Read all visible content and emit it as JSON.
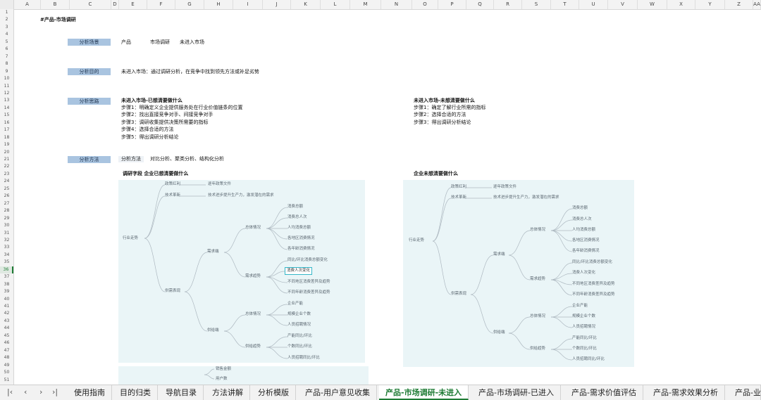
{
  "columns": [
    "A",
    "B",
    "C",
    "D",
    "E",
    "F",
    "G",
    "H",
    "I",
    "J",
    "K",
    "L",
    "M",
    "N",
    "O",
    "P",
    "Q",
    "R",
    "S",
    "T",
    "U",
    "V",
    "W",
    "X",
    "Y",
    "Z",
    "AA"
  ],
  "rows": [
    "1",
    "2",
    "3",
    "4",
    "5",
    "6",
    "7",
    "8",
    "9",
    "10",
    "11",
    "12",
    "13",
    "14",
    "15",
    "16",
    "17",
    "18",
    "19",
    "20",
    "21",
    "22",
    "23",
    "24",
    "25",
    "26",
    "27",
    "28",
    "29",
    "30",
    "31",
    "32",
    "33",
    "34",
    "35",
    "36",
    "37",
    "38",
    "39",
    "40",
    "41",
    "42",
    "43",
    "44",
    "45",
    "46",
    "47",
    "48",
    "49",
    "50",
    "51"
  ],
  "selected_row": "36",
  "sheet": {
    "title": "#产品-市场调研",
    "scene_label": "分析场景",
    "scene_values": [
      "产品",
      "市场调研",
      "未进入市场"
    ],
    "goal_label": "分析目的",
    "goal_text": "未进入市场：通过调研分析，在竞争中找到领先方法或补足劣势",
    "thinking_label": "分析思路",
    "left_heading": "未进入市场-已想清要做什么",
    "left_steps": [
      "步骤1：明确定义企业提供服务处在行业价值链条的位置",
      "步骤2：找出直接竞争对手、间接竞争对手",
      "步骤3：调研收集提供决策所需要的指标",
      "步骤4：选择合适的方法",
      "步骤5：得出调研分析结论"
    ],
    "right_heading": "未进入市场-未想清要做什么",
    "right_steps": [
      "步骤1：确定了解行业所需的指标",
      "步骤2：选择合适的方法",
      "步骤3：得出调研分析结论"
    ],
    "method_label": "分析方法",
    "method_cell_label": "分析方法",
    "method_text": "对比分析、聚类分析、结构化分析",
    "stage_heading": "调研字段 企业已想清要做什么",
    "stage_heading_right": "企业未想清要做什么"
  },
  "mindmap": {
    "root": "行业走势",
    "policy": "政策红利",
    "policy_leaf": "逐年政策文件",
    "tech": "技术革新",
    "tech_leaf": "技术进步提升生产力，激发潜在的需求",
    "supply_demand": "供需表现",
    "demand": "需求端",
    "overall": "总体情况",
    "overall_items": [
      "消费总额",
      "消费总人次",
      "人均消费总额",
      "各地区消费情况",
      "各年龄消费情况"
    ],
    "trend": "需求趋势",
    "trend_items": [
      "同比/环比消费总额变化",
      "消费人次变化",
      "不同地区消费差异及趋势",
      "不同年龄消费差异及趋势"
    ],
    "supply": "供给端",
    "supply_overall": "总体情况",
    "supply_overall_items": [
      "企业产能",
      "规模企业个数",
      "人员招聘情况"
    ],
    "supply_trend": "供给趋势",
    "supply_trend_items": [
      "产能同比/环比",
      "个数同比/环比",
      "人员招聘同比/环比"
    ]
  },
  "bottom_panel": [
    "销售金额",
    "用户数"
  ],
  "tabs": [
    "使用指南",
    "目的归类",
    "导航目录",
    "方法讲解",
    "分析模版",
    "产品-用户意见收集",
    "产品-市场调研-未进入",
    "产品-市场调研-已进入",
    "产品-需求价值评估",
    "产品-需求效果分析",
    "产品-业"
  ],
  "active_tab_index": 6,
  "nav_icons": [
    "first-sheet-icon",
    "prev-sheet-icon",
    "next-sheet-icon",
    "last-sheet-icon"
  ],
  "colors": {
    "accent": "#1e7b34",
    "label_bg": "#a9c4e0",
    "panel_bg": "#eaf5f7",
    "highlight": "#35b6c8"
  }
}
